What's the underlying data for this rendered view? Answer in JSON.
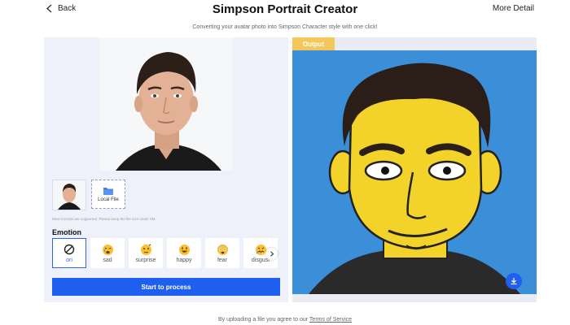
{
  "header": {
    "back_label": "Back",
    "title": "Simpson Portrait Creator",
    "more_label": "More Detail",
    "subtitle": "Converting your avatar photo into Simpson Character style with one click!"
  },
  "upload": {
    "local_file_label": "Local File",
    "hint": "Most formats are supported. Please keep the file size under 5M."
  },
  "emotion": {
    "label": "Emotion",
    "options": [
      {
        "label": "ori",
        "icon": "ban-icon",
        "selected": true
      },
      {
        "label": "sad",
        "icon": "sad-face-icon"
      },
      {
        "label": "surprise",
        "icon": "surprise-face-icon"
      },
      {
        "label": "happy",
        "icon": "happy-face-icon"
      },
      {
        "label": "fear",
        "icon": "fear-face-icon"
      },
      {
        "label": "disgust",
        "icon": "disgust-face-icon"
      }
    ]
  },
  "actions": {
    "process_label": "Start to process"
  },
  "output": {
    "tag": "Output"
  },
  "footer": {
    "text": "By uploading a file you agree to our",
    "link": "Terms of Service"
  },
  "colors": {
    "accent": "#1f5ff0",
    "output_tag": "#f4c75b",
    "panel": "#eef1f9",
    "simpson_skin": "#f3d22a",
    "output_bg": "#3b8fd9"
  }
}
